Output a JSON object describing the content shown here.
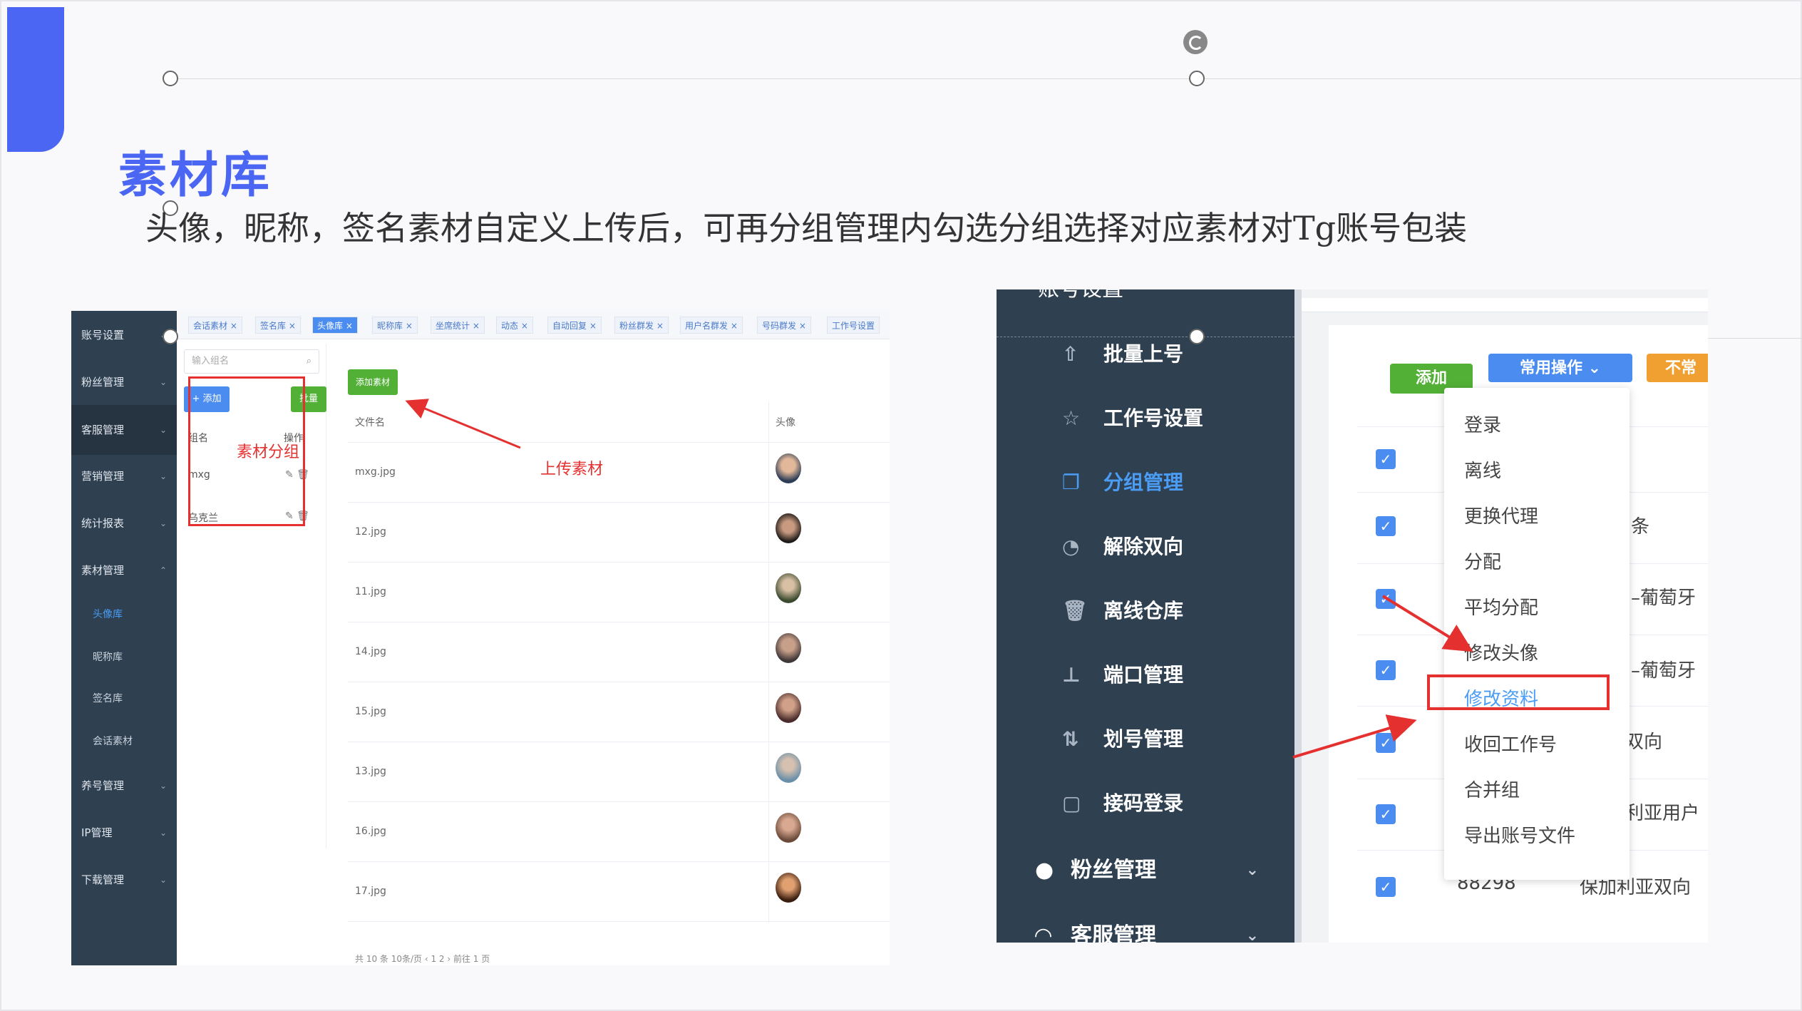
{
  "slide": {
    "title": "素材库",
    "description": "头像，昵称，签名素材自定义上传后，可再分组管理内勾选分组选择对应素材对Tg账号包装"
  },
  "left_screenshot": {
    "sidebar": [
      {
        "label": "账号设置",
        "arrow": "⌄"
      },
      {
        "label": "粉丝管理",
        "arrow": "⌄"
      },
      {
        "label": "客服管理",
        "arrow": "⌄"
      },
      {
        "label": "营销管理",
        "arrow": "⌄"
      },
      {
        "label": "统计报表",
        "arrow": "⌄"
      },
      {
        "label": "素材管理",
        "arrow": "⌃"
      },
      {
        "label": "养号管理",
        "arrow": "⌄"
      },
      {
        "label": "IP管理",
        "arrow": "⌄"
      },
      {
        "label": "下载管理",
        "arrow": "⌄"
      }
    ],
    "subitems": [
      "头像库",
      "昵称库",
      "签名库",
      "会话素材"
    ],
    "tabs": [
      "会话素材 ×",
      "签名库 ×",
      "头像库 ×",
      "昵称库 ×",
      "坐席统计 ×",
      "动态 ×",
      "自动回复 ×",
      "粉丝群发 ×",
      "用户名群发 ×",
      "号码群发 ×",
      "工作号设置"
    ],
    "group_search_placeholder": "输入组名",
    "add_button": "+ 添加",
    "green_button": "批量",
    "group_col_name": "组名",
    "group_col_ops": "操作",
    "groups": [
      "mxg",
      "乌克兰"
    ],
    "annotation_group": "素材分组",
    "upload_button": "添加素材",
    "annotation_upload": "上传素材",
    "col_filename": "文件名",
    "col_avatar": "头像",
    "files": [
      "mxg.jpg",
      "12.jpg",
      "11.jpg",
      "14.jpg",
      "15.jpg",
      "13.jpg",
      "16.jpg",
      "17.jpg"
    ],
    "pager": "共 10 条   10条/页   ‹  1  2  ›   前往  1  页"
  },
  "right_screenshot": {
    "sidebar_top": "账号设置",
    "sidebar_items": [
      {
        "label": "批量上号",
        "icon": "upload-icon",
        "glyph": "⇧"
      },
      {
        "label": "工作号设置",
        "icon": "star-icon",
        "glyph": "☆"
      },
      {
        "label": "分组管理",
        "icon": "group-icon",
        "glyph": "❐"
      },
      {
        "label": "解除双向",
        "icon": "gauge-icon",
        "glyph": "◔"
      },
      {
        "label": "离线仓库",
        "icon": "trash-icon",
        "glyph": "🗑"
      },
      {
        "label": "端口管理",
        "icon": "port-icon",
        "glyph": "⊥"
      },
      {
        "label": "划号管理",
        "icon": "transfer-icon",
        "glyph": "⇅"
      },
      {
        "label": "接码登录",
        "icon": "phone-icon",
        "glyph": "▢"
      }
    ],
    "parent_fans": "粉丝管理",
    "parent_cs": "客服管理",
    "btn_add": "添加",
    "btn_common": "常用操作 ⌄",
    "btn_unused": "不常",
    "menu_items": [
      "登录",
      "离线",
      "更换代理",
      "分配",
      "平均分配",
      "修改头像",
      "修改资料",
      "收回工作号",
      "合并组",
      "导出账号文件"
    ],
    "right_cells": [
      "条",
      "–葡萄牙",
      "–葡萄牙",
      "双向",
      "利亚用户",
      "保加利亚双向"
    ],
    "row_number": "88298",
    "accent": "#4a66f3",
    "annotation_color": "#e53030"
  }
}
